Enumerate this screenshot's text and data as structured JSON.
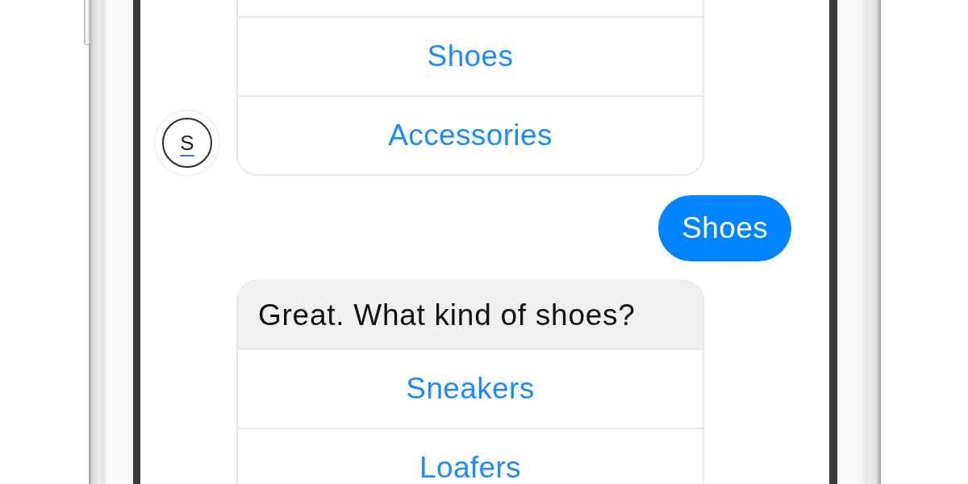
{
  "conversation": [
    {
      "kind": "bot_options",
      "avatar": {
        "letter": "S"
      },
      "options": [
        "Shoes",
        "Accessories"
      ]
    },
    {
      "kind": "user_text",
      "text": "Shoes"
    },
    {
      "kind": "bot_card",
      "text": "Great. What kind of shoes?",
      "options": [
        "Sneakers",
        "Loafers"
      ]
    }
  ]
}
